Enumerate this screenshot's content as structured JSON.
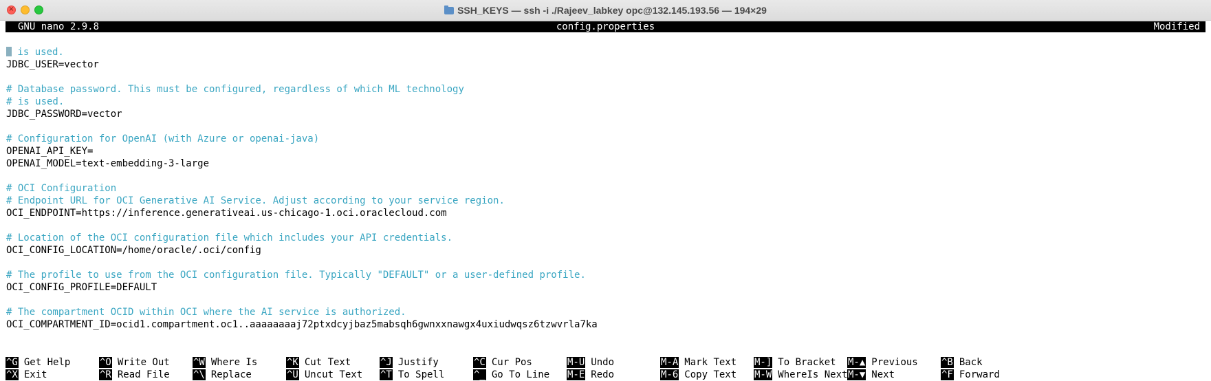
{
  "window": {
    "title": "SSH_KEYS — ssh -i ./Rajeev_labkey opc@132.145.193.56 — 194×29"
  },
  "nano": {
    "version": "GNU nano 2.9.8",
    "filename": "config.properties",
    "status": "Modified"
  },
  "editor": {
    "first_line_text": " is used.",
    "lines": [
      {
        "text": "JDBC_USER=vector",
        "type": "code"
      },
      {
        "text": "",
        "type": "blank"
      },
      {
        "text": "# Database password. This must be configured, regardless of which ML technology",
        "type": "comment"
      },
      {
        "text": "# is used.",
        "type": "comment"
      },
      {
        "text": "JDBC_PASSWORD=vector",
        "type": "code"
      },
      {
        "text": "",
        "type": "blank"
      },
      {
        "text": "# Configuration for OpenAI (with Azure or openai-java)",
        "type": "comment"
      },
      {
        "text": "OPENAI_API_KEY=",
        "type": "code"
      },
      {
        "text": "OPENAI_MODEL=text-embedding-3-large",
        "type": "code"
      },
      {
        "text": "",
        "type": "blank"
      },
      {
        "text": "# OCI Configuration",
        "type": "comment"
      },
      {
        "text": "# Endpoint URL for OCI Generative AI Service. Adjust according to your service region.",
        "type": "comment"
      },
      {
        "text": "OCI_ENDPOINT=https://inference.generativeai.us-chicago-1.oci.oraclecloud.com",
        "type": "code"
      },
      {
        "text": "",
        "type": "blank"
      },
      {
        "text": "# Location of the OCI configuration file which includes your API credentials.",
        "type": "comment"
      },
      {
        "text": "OCI_CONFIG_LOCATION=/home/oracle/.oci/config",
        "type": "code"
      },
      {
        "text": "",
        "type": "blank"
      },
      {
        "text": "# The profile to use from the OCI configuration file. Typically \"DEFAULT\" or a user-defined profile.",
        "type": "comment"
      },
      {
        "text": "OCI_CONFIG_PROFILE=DEFAULT",
        "type": "code"
      },
      {
        "text": "",
        "type": "blank"
      },
      {
        "text": "# The compartment OCID within OCI where the AI service is authorized.",
        "type": "comment"
      },
      {
        "text": "OCI_COMPARTMENT_ID=ocid1.compartment.oc1..aaaaaaaaj72ptxdcyjbaz5mabsqh6gwnxxnawgx4uxiudwqsz6tzwvrla7ka",
        "type": "code"
      }
    ]
  },
  "shortcuts": {
    "row1": [
      {
        "key": "^G",
        "label": "Get Help"
      },
      {
        "key": "^O",
        "label": "Write Out"
      },
      {
        "key": "^W",
        "label": "Where Is"
      },
      {
        "key": "^K",
        "label": "Cut Text"
      },
      {
        "key": "^J",
        "label": "Justify"
      },
      {
        "key": "^C",
        "label": "Cur Pos"
      },
      {
        "key": "M-U",
        "label": "Undo"
      },
      {
        "key": "M-A",
        "label": "Mark Text"
      },
      {
        "key": "M-]",
        "label": "To Bracket"
      },
      {
        "key": "M-▲",
        "label": "Previous"
      },
      {
        "key": "^B",
        "label": "Back"
      }
    ],
    "row2": [
      {
        "key": "^X",
        "label": "Exit"
      },
      {
        "key": "^R",
        "label": "Read File"
      },
      {
        "key": "^\\",
        "label": "Replace"
      },
      {
        "key": "^U",
        "label": "Uncut Text"
      },
      {
        "key": "^T",
        "label": "To Spell"
      },
      {
        "key": "^_",
        "label": "Go To Line"
      },
      {
        "key": "M-E",
        "label": "Redo"
      },
      {
        "key": "M-6",
        "label": "Copy Text"
      },
      {
        "key": "M-W",
        "label": "WhereIs Next"
      },
      {
        "key": "M-▼",
        "label": "Next"
      },
      {
        "key": "^F",
        "label": "Forward"
      }
    ]
  },
  "colors": {
    "comment": "#3aa6c2",
    "code": "#000000",
    "bar_background": "#000000",
    "bar_text": "#ffffff"
  }
}
